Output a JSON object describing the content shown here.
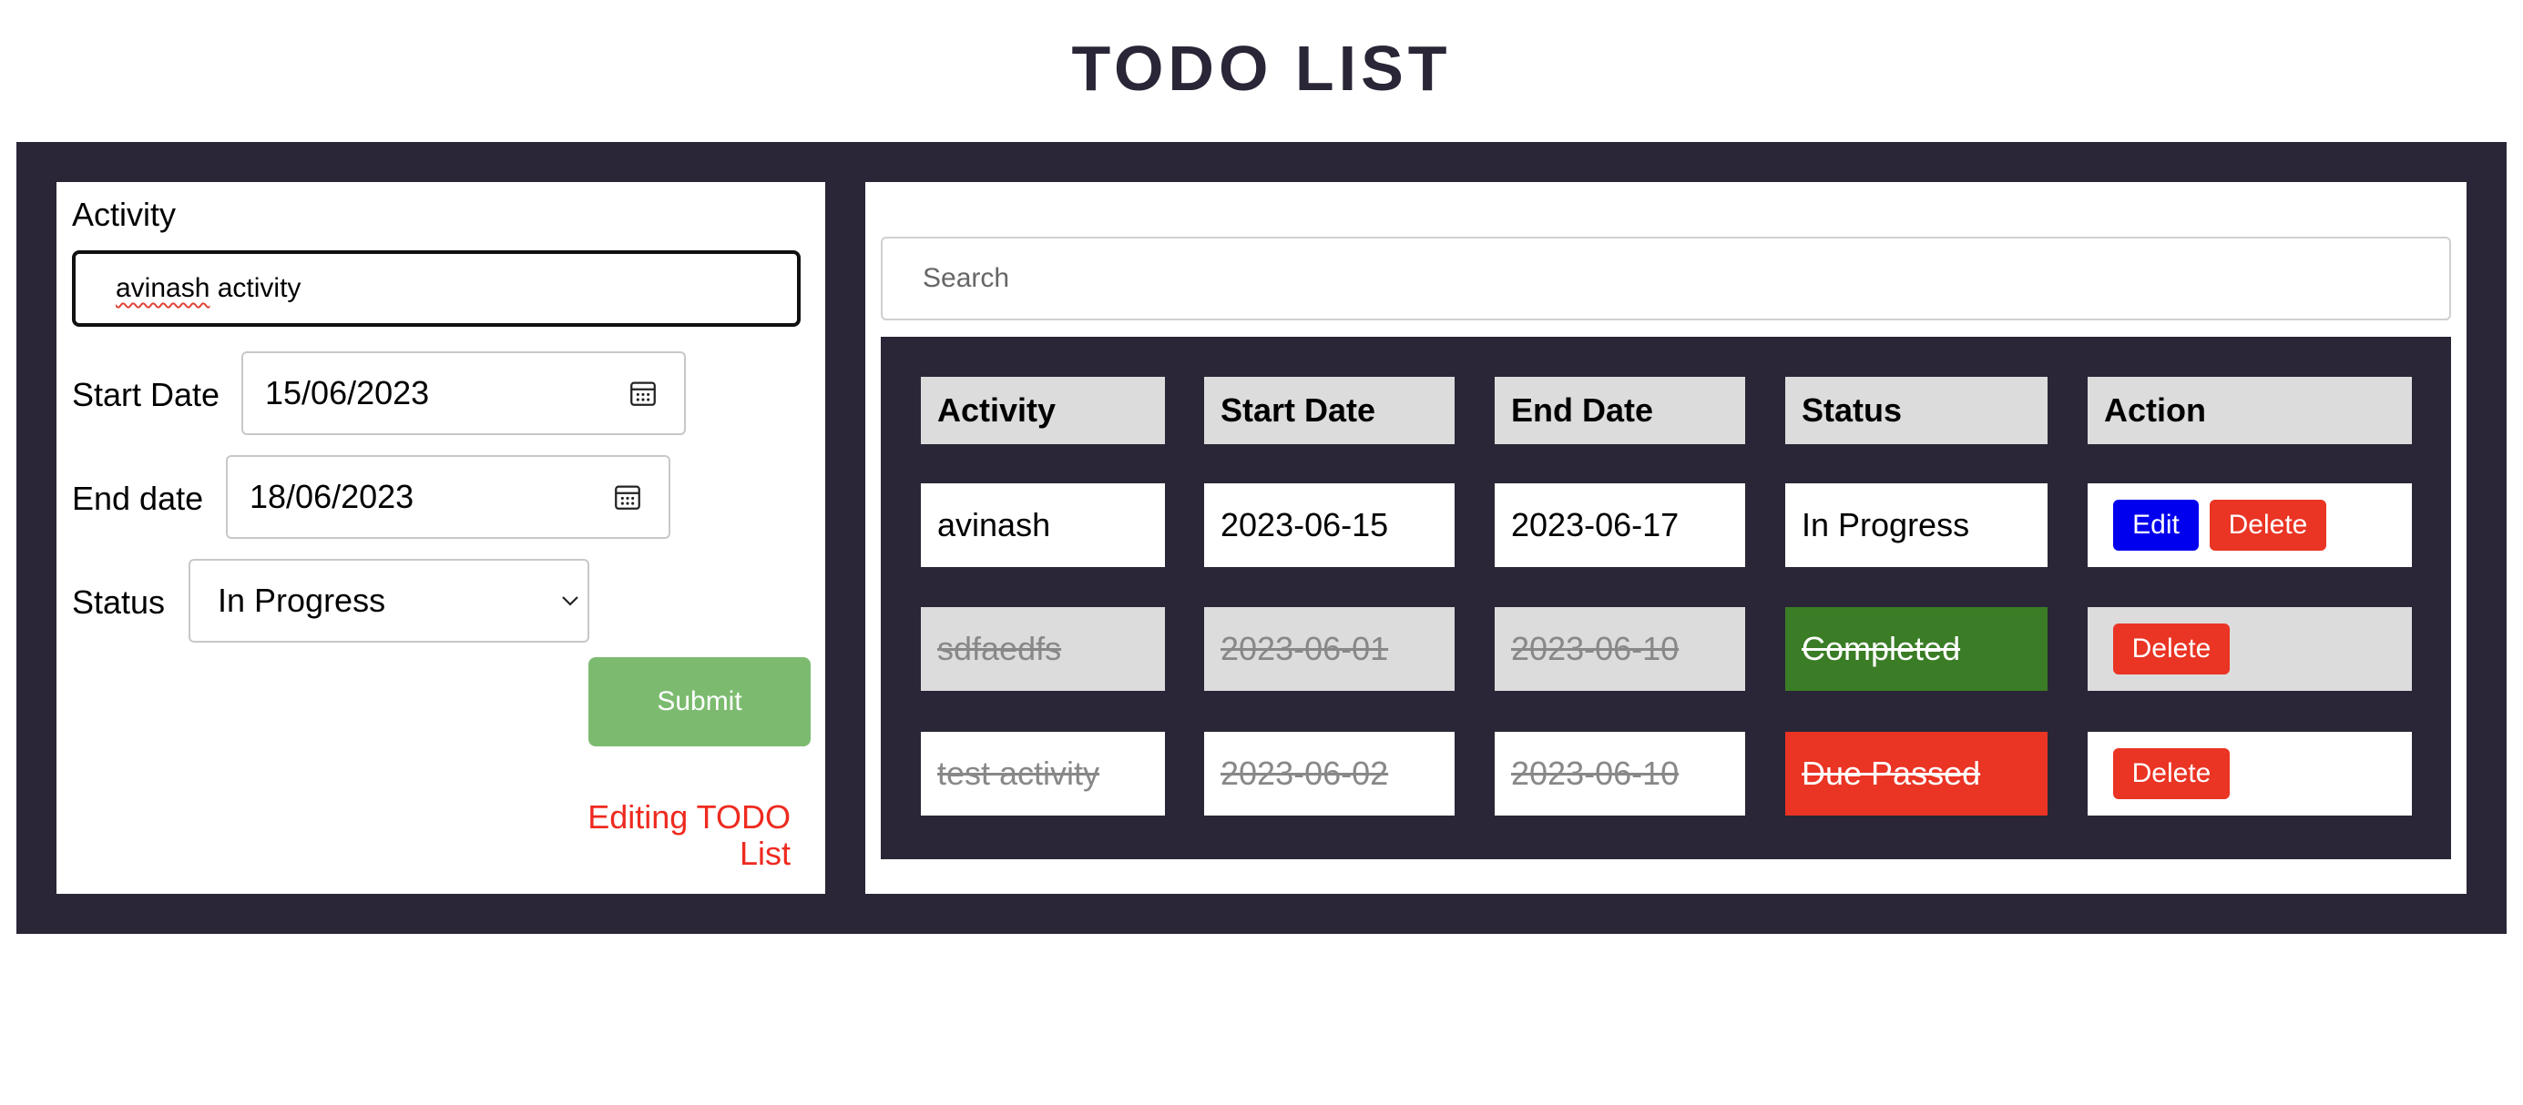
{
  "page": {
    "title": "TODO LIST"
  },
  "form": {
    "activity_label": "Activity",
    "activity_value_word1": "avinash",
    "activity_value_rest": " activity",
    "start_date_label": "Start Date",
    "start_date_value": "15/06/2023",
    "end_date_label": "End date",
    "end_date_value": "18/06/2023",
    "status_label": "Status",
    "status_value": "In Progress",
    "submit_label": "Submit",
    "editing_text": "Editing TODO List"
  },
  "search": {
    "placeholder": "Search"
  },
  "table": {
    "headers": [
      "Activity",
      "Start Date",
      "End Date",
      "Status",
      "Action"
    ],
    "rows": [
      {
        "activity": "avinash",
        "start": "2023-06-15",
        "end": "2023-06-17",
        "status": "In Progress",
        "edit": "Edit",
        "delete": "Delete"
      },
      {
        "activity": "sdfaedfs",
        "start": "2023-06-01",
        "end": "2023-06-10",
        "status": "Completed",
        "delete": "Delete"
      },
      {
        "activity": "test activity",
        "start": "2023-06-02",
        "end": "2023-06-10",
        "status": "Due Passed",
        "delete": "Delete"
      }
    ]
  },
  "colors": {
    "frame": "#2a2637",
    "submit": "#7cbb6f",
    "edit_button": "#0000ee",
    "delete_button": "#ea3424",
    "status_completed": "#3a7d26",
    "status_due_passed": "#ea3424",
    "editing_text": "#ee2a1f"
  },
  "icons": {
    "date_picker": "calendar-icon",
    "select": "chevron-down-icon"
  }
}
